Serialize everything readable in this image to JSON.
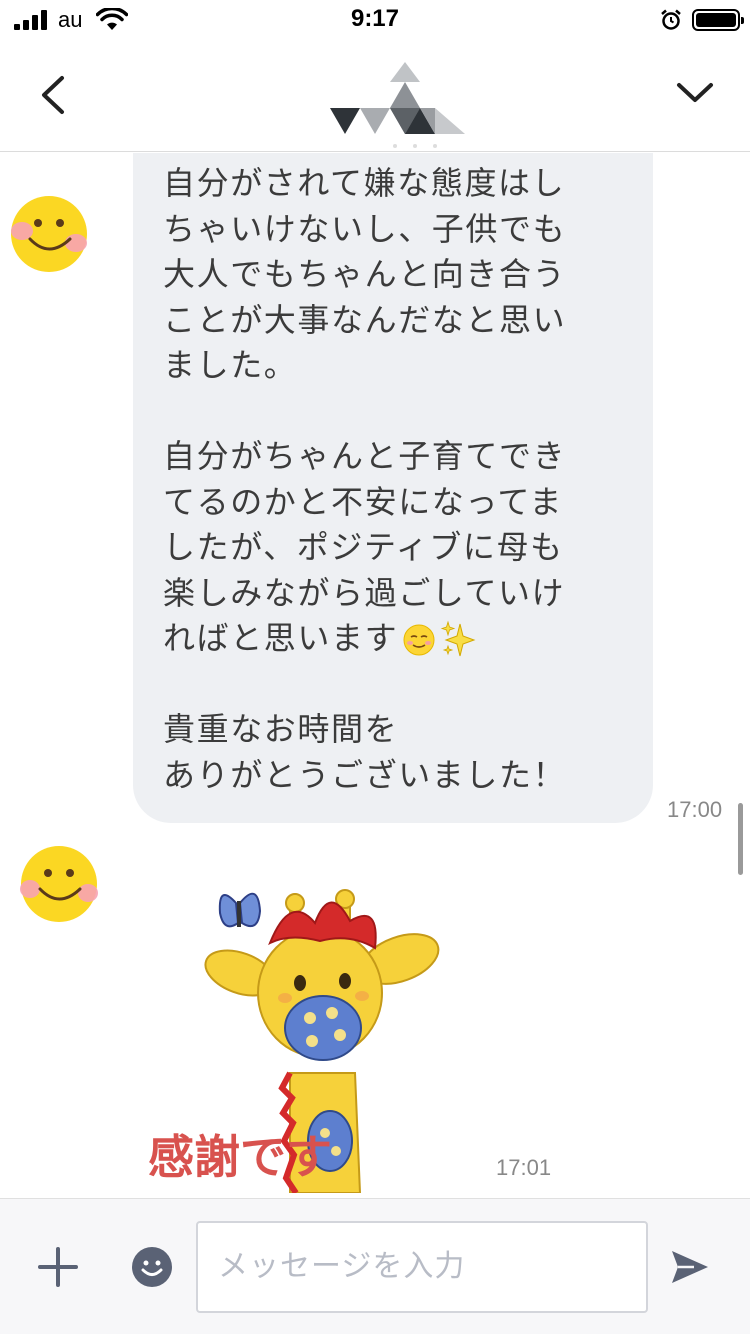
{
  "status_bar": {
    "carrier": "au",
    "time": "9:17"
  },
  "header": {
    "logo_icon": "triangles-logo-icon",
    "back_icon": "chevron-left-icon",
    "menu_icon": "chevron-down-icon"
  },
  "messages": [
    {
      "sender_avatar": "smiley-face-icon",
      "lines": [
        "自分がされて嫌な態度はし",
        "ちゃいけないし、子供でも",
        "大人でもちゃんと向き合う",
        "ことが大事なんだなと思い",
        "ました。",
        "",
        "自分がちゃんと子育てでき",
        "てるのかと不安になってま",
        "したが、ポジティブに母も",
        "楽しみながら過ごしていけ",
        "ればと思います",
        "",
        "貴重なお時間を",
        "ありがとうございました！"
      ],
      "emojis": [
        "relieved-face-icon",
        "sparkles-icon"
      ],
      "time": "17:00"
    },
    {
      "sender_avatar": "smiley-face-icon",
      "sticker": {
        "icon": "giraffe-sticker-icon",
        "caption": "感謝です"
      },
      "time": "17:01"
    }
  ],
  "input_bar": {
    "placeholder": "メッセージを入力",
    "plus_icon": "plus-icon",
    "emoji_icon": "emoji-icon",
    "send_icon": "send-icon"
  },
  "colors": {
    "bubble": "#eef0f3",
    "sticker_caption": "#d8524e"
  }
}
